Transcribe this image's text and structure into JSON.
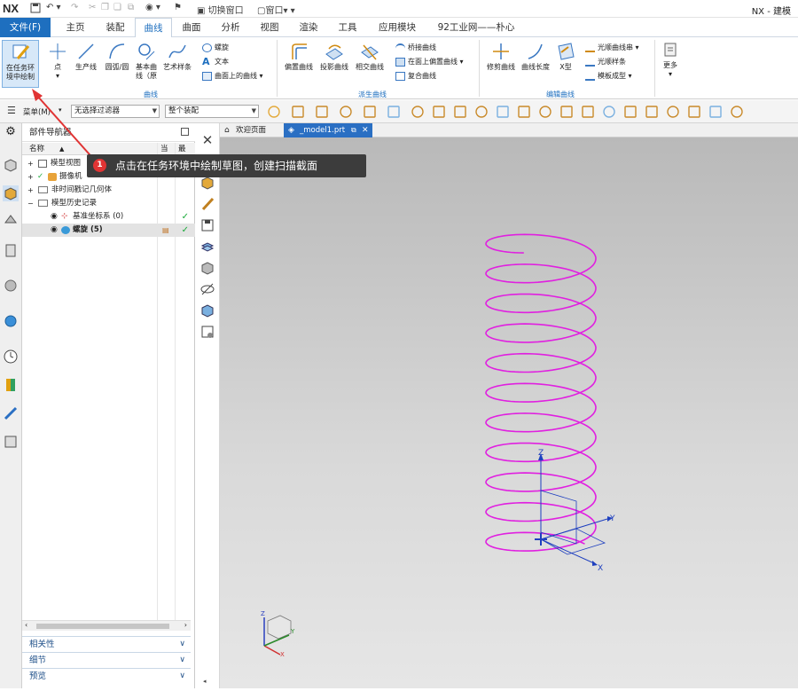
{
  "titlebar": {
    "logo": "NX",
    "switch_window": "切换窗口",
    "window_menu": "窗口",
    "window_title": "NX - 建模"
  },
  "menubar": {
    "tabs": [
      "文件(F)",
      "主页",
      "装配",
      "曲线",
      "曲面",
      "分析",
      "视图",
      "渲染",
      "工具",
      "应用模块",
      "92工业网——朴心"
    ]
  },
  "ribbon": {
    "sketch_in_task": "在任务环\n境中绘制",
    "point": "点",
    "production_line": "生产线",
    "arc_circle": "圆弧/圆",
    "basic_curve": "基本曲\n线（原",
    "art_spline": "艺术样条",
    "helix": "螺旋",
    "text": "文本",
    "curve_on_surface": "曲面上的曲线",
    "group_curve": "曲线",
    "offset_curve": "偏置曲线",
    "project_curve": "投影曲线",
    "intersect_curve": "相交曲线",
    "bridge_curve": "桥接曲线",
    "offset_on_face": "在面上偏置曲线",
    "composite_curve": "复合曲线",
    "group_derived": "派生曲线",
    "trim_curve": "修剪曲线",
    "curve_length": "曲线长度",
    "x_form": "X型",
    "smooth_curve_chain": "光顺曲线串",
    "smooth_spline": "光顺样条",
    "template_forming": "模板成型",
    "group_edit": "编辑曲线",
    "more": "更多"
  },
  "selbar": {
    "menu": "菜单(M)",
    "filter": "无选择过滤器",
    "assembly": "整个装配"
  },
  "navigator": {
    "title": "部件导航器",
    "col_name": "名称",
    "col_current": "当",
    "col_latest": "最",
    "rows": [
      {
        "label": "模型视图"
      },
      {
        "label": "摄像机"
      },
      {
        "label": "非时间戳记几何体"
      },
      {
        "label": "模型历史记录"
      },
      {
        "label": "基准坐标系 (0)"
      },
      {
        "label": "螺旋 (5)"
      }
    ],
    "accordion": [
      "相关性",
      "细节",
      "预览"
    ]
  },
  "viewtabs": {
    "welcome": "欢迎页面",
    "model": "_model1.prt"
  },
  "callout": {
    "number": "1",
    "text": "点击在任务环境中绘制草图，创建扫描截面"
  },
  "axes": {
    "x": "X",
    "y": "Y",
    "z": "Z"
  },
  "colors": {
    "accent": "#1e6fbf",
    "helix": "#e020e0",
    "arrow": "#e03434",
    "check": "#1aaa3a"
  }
}
